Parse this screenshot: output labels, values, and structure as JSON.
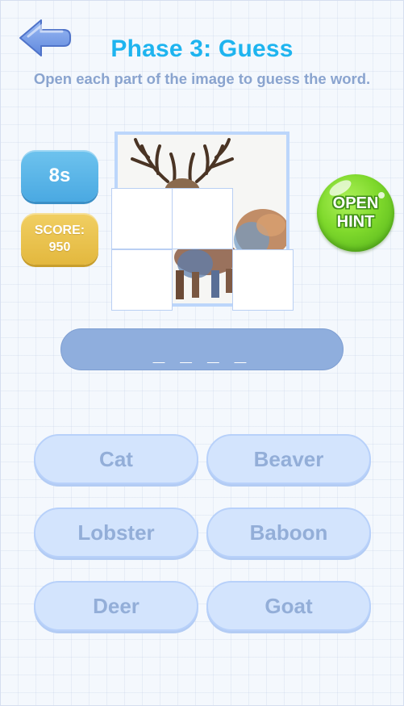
{
  "header": {
    "back_icon": "back-arrow-icon",
    "title": "Phase 3: Guess",
    "subtitle": "Open each part of the image to guess the word."
  },
  "stats": {
    "timer": "8s",
    "score_label": "SCORE:",
    "score_value": "950"
  },
  "puzzle": {
    "image_subject": "watercolor deer",
    "grid": "3x3",
    "tiles_revealed_fraction": 0.5556
  },
  "hint": {
    "line1": "OPEN",
    "line2": "HINT"
  },
  "answer": {
    "placeholder": "_ _ _ _"
  },
  "options": [
    "Cat",
    "Beaver",
    "Lobster",
    "Baboon",
    "Deer",
    "Goat"
  ],
  "colors": {
    "title": "#1eb4ef",
    "timer_bg": "#55b0e6",
    "score_bg": "#e8bf4a",
    "hint_bg": "#7fd92c",
    "answer_bg": "#8faedd",
    "option_bg": "#d3e4fd",
    "option_text": "#93aed8"
  }
}
